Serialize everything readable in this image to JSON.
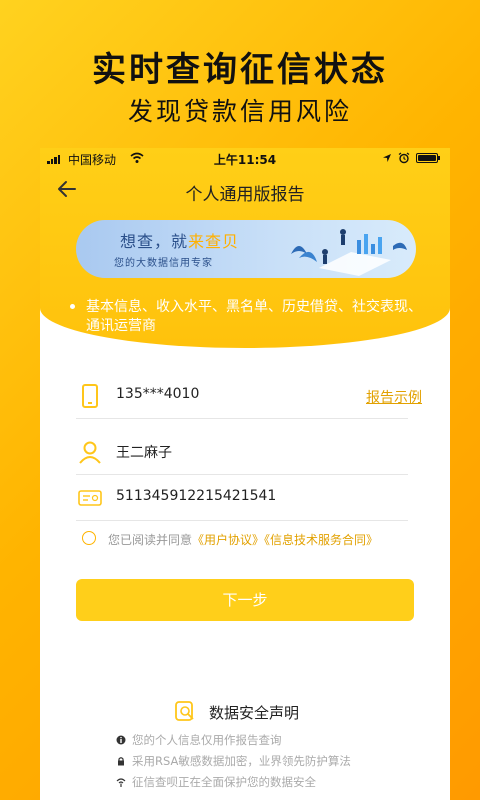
{
  "promo": {
    "title": "实时查询征信状态",
    "subtitle": "发现贷款信用风险"
  },
  "status_bar": {
    "carrier": "中国移动",
    "time": "上午11:54",
    "icons": [
      "signal-icon",
      "wifi-icon",
      "location-icon",
      "alarm-icon",
      "battery-icon"
    ]
  },
  "nav": {
    "back_icon": "back-arrow-icon",
    "title": "个人通用版报告"
  },
  "banner": {
    "main_prefix": "想查，就",
    "main_highlight": "来查贝",
    "subtitle": "您的大数据信用专家"
  },
  "features": {
    "text": "基本信息、收入水平、黑名单、历史借贷、社交表现、通讯运营商"
  },
  "form": {
    "phone": {
      "icon": "phone-icon",
      "value": "135***4010",
      "example_link": "报告示例"
    },
    "name": {
      "icon": "user-icon",
      "value": "王二麻子"
    },
    "id_card": {
      "icon": "id-card-icon",
      "value": "511345912215421541"
    }
  },
  "agreement": {
    "prefix": "您已阅读并同意",
    "user_agreement": "《用户协议》",
    "service_contract": "《信息技术服务合同》"
  },
  "next_button": {
    "label": "下一步"
  },
  "security": {
    "title": "数据安全声明",
    "items": [
      "您的个人信息仅用作报告查询",
      "采用RSA敏感数据加密，业界领先防护算法",
      "征信查呗正在全面保护您的数据安全"
    ]
  },
  "colors": {
    "accent": "#ffc20c",
    "link": "#e2a100",
    "button": "#ffcf1a"
  }
}
